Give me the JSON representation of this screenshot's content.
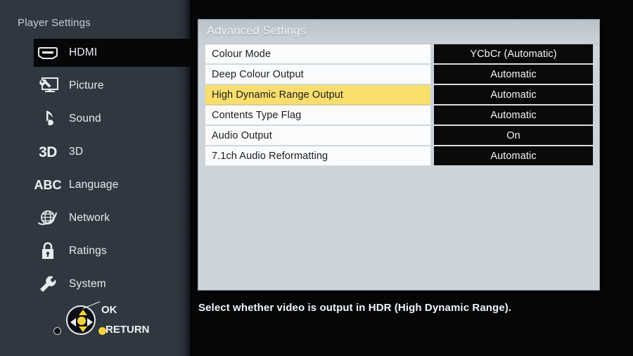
{
  "sidebar": {
    "title": "Player Settings",
    "items": [
      {
        "label": "HDMI",
        "icon": "hdmi-port-icon",
        "selected": true
      },
      {
        "label": "Picture",
        "icon": "monitor-wrench-icon",
        "selected": false
      },
      {
        "label": "Sound",
        "icon": "music-note-icon",
        "selected": false
      },
      {
        "label": "3D",
        "icon": "3d-icon",
        "selected": false
      },
      {
        "label": "Language",
        "icon": "abc-icon",
        "selected": false
      },
      {
        "label": "Network",
        "icon": "globe-icon",
        "selected": false
      },
      {
        "label": "Ratings",
        "icon": "padlock-icon",
        "selected": false
      },
      {
        "label": "System",
        "icon": "wrench-icon",
        "selected": false
      }
    ],
    "legend": {
      "ok": "OK",
      "return": "RETURN"
    }
  },
  "panel": {
    "title": "Advanced Settings",
    "rows": [
      {
        "label": "Colour Mode",
        "value": "YCbCr (Automatic)",
        "highlight": false
      },
      {
        "label": "Deep Colour Output",
        "value": "Automatic",
        "highlight": false
      },
      {
        "label": "High Dynamic Range Output",
        "value": "Automatic",
        "highlight": true
      },
      {
        "label": "Contents Type Flag",
        "value": "Automatic",
        "highlight": false
      },
      {
        "label": "Audio Output",
        "value": "On",
        "highlight": false
      },
      {
        "label": "7.1ch Audio Reformatting",
        "value": "Automatic",
        "highlight": false
      }
    ]
  },
  "description": "Select whether video is output in HDR (High Dynamic Range).",
  "colors": {
    "background": "#050608",
    "sidebar": "#2f3740",
    "panel": "#ccd4da",
    "highlight": "#fade6e",
    "value_box": "#0a0a0b",
    "accent_yellow": "#f5d23c"
  }
}
